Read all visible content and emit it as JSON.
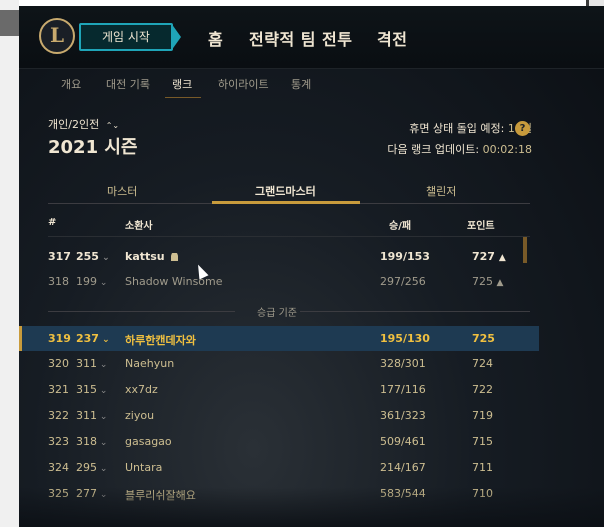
{
  "nav": {
    "logo": "L",
    "play_button": "게임 시작",
    "items": [
      "홈",
      "전략적 팀 전투",
      "격전"
    ]
  },
  "subnav": {
    "tabs": [
      "개요",
      "대전 기록",
      "랭크",
      "하이라이트",
      "통계"
    ],
    "active": "랭크"
  },
  "header": {
    "queue_label": "개인/2인전",
    "queue_chevron": "⌃⌄",
    "season": "2021 시즌",
    "rest_label": "휴면 상태 돌입 예정:",
    "rest_value": "10일",
    "help_icon": "?",
    "update_label": "다음 랭크 업데이트:",
    "update_value": "00:02:18"
  },
  "tiers": [
    "마스터",
    "그랜드마스터",
    "챌린저"
  ],
  "active_tier": "그랜드마스터",
  "table": {
    "headers": {
      "rank": "#",
      "summoner": "소환사",
      "winloss": "승/패",
      "points": "포인트"
    },
    "promo_label": "승급 기준",
    "rows": [
      {
        "rank": "317",
        "prev": "255",
        "name": "kattsu",
        "wl": "199/153",
        "points": "727",
        "trend": "▲"
      },
      {
        "rank": "318",
        "prev": "199",
        "name": "Shadow Winsome",
        "wl": "297/256",
        "points": "725",
        "trend": "▲"
      },
      {
        "rank": "319",
        "prev": "237",
        "name": "하루한캔데자와",
        "wl": "195/130",
        "points": "725",
        "trend": ""
      },
      {
        "rank": "320",
        "prev": "311",
        "name": "Naehyun",
        "wl": "328/301",
        "points": "724",
        "trend": ""
      },
      {
        "rank": "321",
        "prev": "315",
        "name": "xx7dz",
        "wl": "177/116",
        "points": "722",
        "trend": ""
      },
      {
        "rank": "322",
        "prev": "311",
        "name": "ziyou",
        "wl": "361/323",
        "points": "719",
        "trend": ""
      },
      {
        "rank": "323",
        "prev": "318",
        "name": "gasagao",
        "wl": "509/461",
        "points": "715",
        "trend": ""
      },
      {
        "rank": "324",
        "prev": "295",
        "name": "Untara",
        "wl": "214/167",
        "points": "711",
        "trend": ""
      },
      {
        "rank": "325",
        "prev": "277",
        "name": "블루리쉬잘해요",
        "wl": "583/544",
        "points": "710",
        "trend": ""
      }
    ]
  },
  "colors": {
    "gold": "#c89b3c",
    "highlight_row": "#1e3a52",
    "teal": "#1fa5b8"
  }
}
